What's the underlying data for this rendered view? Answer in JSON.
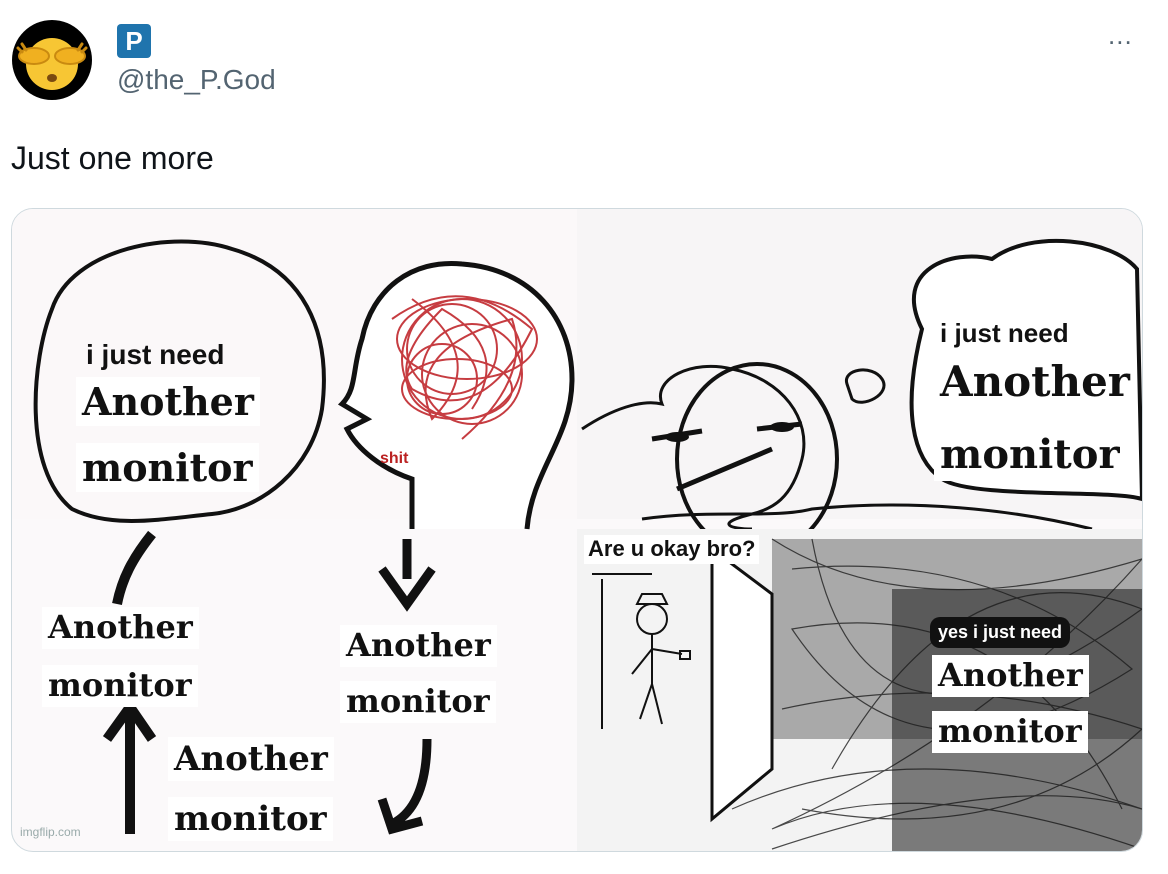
{
  "header": {
    "handle": "@the_P.God",
    "badge_letter": "P",
    "more_label": "...",
    "avatar_icon": "covering-eyes-emoji"
  },
  "tweet": {
    "text": "Just one more"
  },
  "meme": {
    "panel1": {
      "line1": "i just need",
      "line2": "Another",
      "line3": "monitor",
      "brain_text": "shit"
    },
    "panel2": {
      "line1": "i just need",
      "line2": "Another",
      "line3": "monitor"
    },
    "cycle": [
      {
        "line1": "Another",
        "line2": "monitor"
      },
      {
        "line1": "Another",
        "line2": "monitor"
      },
      {
        "line1": "Another",
        "line2": "monitor"
      }
    ],
    "panel4": {
      "question": "Are u okay bro?",
      "answer_line1": "yes i just need",
      "answer_line2": "Another",
      "answer_line3": "monitor"
    },
    "watermark": "imgflip.com"
  }
}
